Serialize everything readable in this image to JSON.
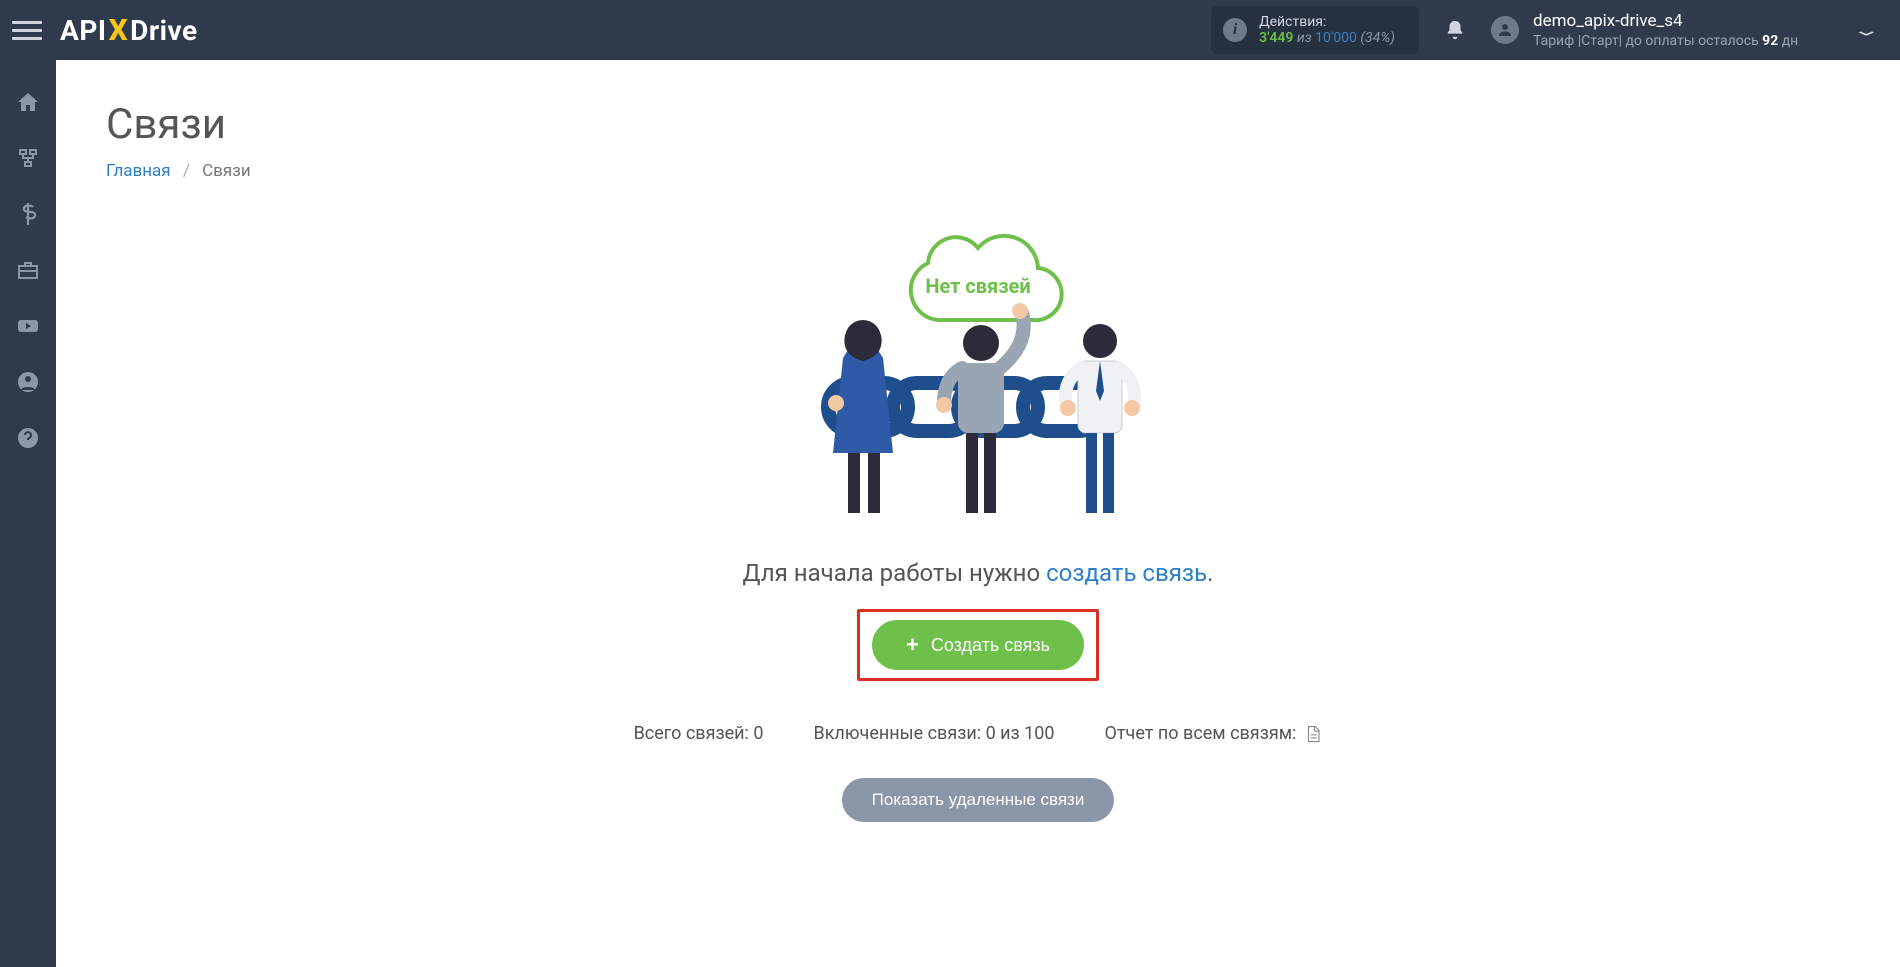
{
  "brand": {
    "part1": "API",
    "x": "X",
    "part2": "Drive"
  },
  "topbar": {
    "actions_label": "Действия:",
    "actions_used": "3'449",
    "actions_of_word": "из",
    "actions_total": "10'000",
    "actions_pct": "(34%)"
  },
  "user": {
    "name": "demo_apix-drive_s4",
    "tariff_prefix": "Тариф |Старт| до оплаты осталось ",
    "tariff_days": "92",
    "tariff_suffix": " дн"
  },
  "page": {
    "title": "Связи",
    "breadcrumb_home": "Главная",
    "breadcrumb_current": "Связи"
  },
  "illustration": {
    "cloud_text": "Нет связей"
  },
  "content": {
    "instruction_prefix": "Для начала работы нужно ",
    "instruction_link": "создать связь",
    "instruction_suffix": ".",
    "create_button": "Создать связь"
  },
  "stats": {
    "total_label": "Всего связей:",
    "total_value": "0",
    "enabled_label": "Включенные связи:",
    "enabled_value": "0 из 100",
    "report_label": "Отчет по всем связям:"
  },
  "footer": {
    "show_deleted": "Показать удаленные связи"
  },
  "sidebar_icons": [
    "home",
    "connections",
    "billing",
    "briefcase",
    "video",
    "account",
    "help"
  ]
}
